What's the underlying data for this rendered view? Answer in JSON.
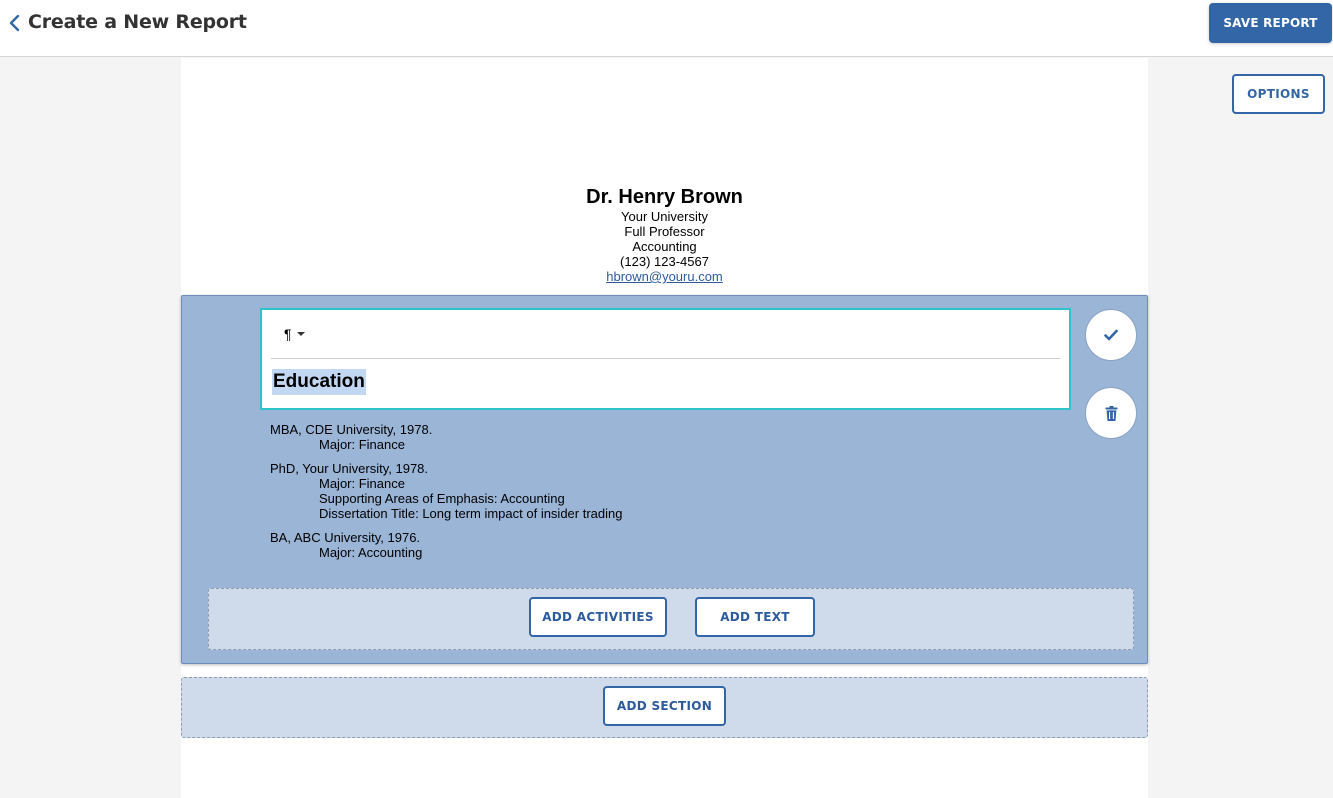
{
  "header": {
    "title": "Create a New Report",
    "save_label": "SAVE REPORT",
    "options_label": "OPTIONS"
  },
  "profile": {
    "name": "Dr. Henry Brown",
    "university": "Your University",
    "rank": "Full Professor",
    "department": "Accounting",
    "phone": "(123) 123-4567",
    "email": "hbrown@youru.com"
  },
  "editor": {
    "format_symbol": "¶",
    "heading": "Education"
  },
  "entries": [
    {
      "title": "MBA, CDE University, 1978.",
      "details": [
        "Major: Finance"
      ]
    },
    {
      "title": "PhD, Your University, 1978.",
      "details": [
        "Major: Finance",
        "Supporting Areas of Emphasis: Accounting",
        "Dissertation Title: Long term impact of insider trading"
      ]
    },
    {
      "title": "BA, ABC University, 1976.",
      "details": [
        "Major: Accounting"
      ]
    }
  ],
  "actions": {
    "add_activities": "ADD ACTIVITIES",
    "add_text": "ADD TEXT",
    "add_section": "ADD SECTION"
  },
  "colors": {
    "accent": "#3366a6",
    "section_bg": "#9bb5d7",
    "drop_zone_bg": "#cfdbeb",
    "editor_border": "#2ec4c9"
  },
  "icons": {
    "back": "chevron-left-icon",
    "confirm": "check-icon",
    "delete": "trash-icon",
    "format": "paragraph-icon"
  }
}
